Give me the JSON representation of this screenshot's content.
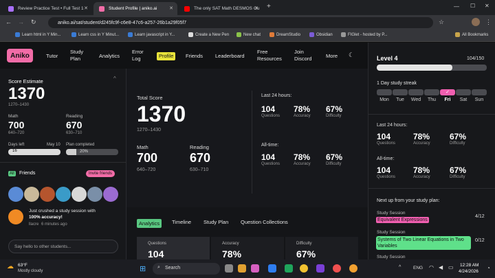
{
  "browser": {
    "tabs": [
      {
        "title": "Review Practice Test • Full Test 1",
        "color": "#a970ff"
      },
      {
        "title": "Student Profile | aniko.ai",
        "color": "#f26ca7"
      },
      {
        "title": "The only SAT Math DESMOS Gu",
        "color": "#ff0000"
      }
    ],
    "url": "aniko.ai/sat/student/d245fc9f-c6e8-47c6-a257-26b1a29f05f7",
    "bookmarks": [
      "Learn html in Y Min...",
      "Learn css in Y Minut...",
      "Learn javascript in Y...",
      "Create a New Pen",
      "New chat",
      "DreamStudio",
      "Obsidian",
      "FIGlet - hosted by P...",
      "All Bookmarks"
    ]
  },
  "nav": {
    "logo": "Aniko",
    "items": [
      "Tutor",
      "Study Plan",
      "Analytics",
      "Error Log",
      "Profile",
      "Friends",
      "Leaderboard",
      "Free Resources",
      "Join Discord",
      "More"
    ]
  },
  "left": {
    "score_label": "Score Estimate",
    "score": "1370",
    "score_range": "1270–1430",
    "math_label": "Math",
    "math": "700",
    "math_range": "640–720",
    "reading_label": "Reading",
    "reading": "670",
    "reading_range": "630–710",
    "days_left_label": "Days left",
    "days_left_date": "May 10",
    "days_left_value": "16",
    "plan_label": "Plan completed",
    "plan_value": "20%",
    "friends_badge": "All",
    "friends_label": "Friends",
    "invite": "Invite friends",
    "activity_text": "Just crushed a study session with",
    "activity_bold": "100% accuracy!",
    "activity_user": "llacre",
    "activity_time": "6 minutes ago",
    "chat_placeholder": "Say hello to other students..."
  },
  "center": {
    "total_label": "Total Score",
    "total": "1370",
    "total_range": "1270–1430",
    "math_label": "Math",
    "math": "700",
    "math_range": "640–720",
    "reading_label": "Reading",
    "reading": "670",
    "reading_range": "630–710",
    "last24_label": "Last 24 hours:",
    "alltime_label": "All-time:",
    "last24": {
      "questions": "104",
      "accuracy": "78%",
      "difficulty": "67%"
    },
    "alltime": {
      "questions": "104",
      "accuracy": "78%",
      "difficulty": "67%"
    },
    "q_label": "Questions",
    "a_label": "Accuracy",
    "d_label": "Difficulty",
    "tabs": [
      "Analytics",
      "Timeline",
      "Study Plan",
      "Question Collections"
    ],
    "cards": {
      "questions": "104",
      "accuracy": "78%",
      "difficulty": "67%"
    },
    "chart_tick": "100"
  },
  "right": {
    "level": "Level 4",
    "xp": "104/150",
    "streak": "1 Day study streak",
    "days": [
      "Mon",
      "Tue",
      "Wed",
      "Thu",
      "Fri",
      "Sat",
      "Sun"
    ],
    "last24_label": "Last 24 hours:",
    "alltime_label": "All-time:",
    "last24": {
      "questions": "104",
      "accuracy": "78%",
      "difficulty": "67%"
    },
    "alltime": {
      "questions": "104",
      "accuracy": "78%",
      "difficulty": "67%"
    },
    "next_label": "Next up from your study plan:",
    "session_label": "Study Session",
    "session1": "Equivalent Expressions",
    "session1_count": "4/12",
    "session2": "Systems of Two Linear Equations in Two Variables",
    "session2_count": "0/12",
    "session3_label": "Study Session"
  },
  "taskbar": {
    "weather_temp": "63°F",
    "weather_desc": "Mostly cloudy",
    "search": "Search",
    "lang": "ENG",
    "time": "12:28 AM",
    "date": "4/24/2026"
  }
}
